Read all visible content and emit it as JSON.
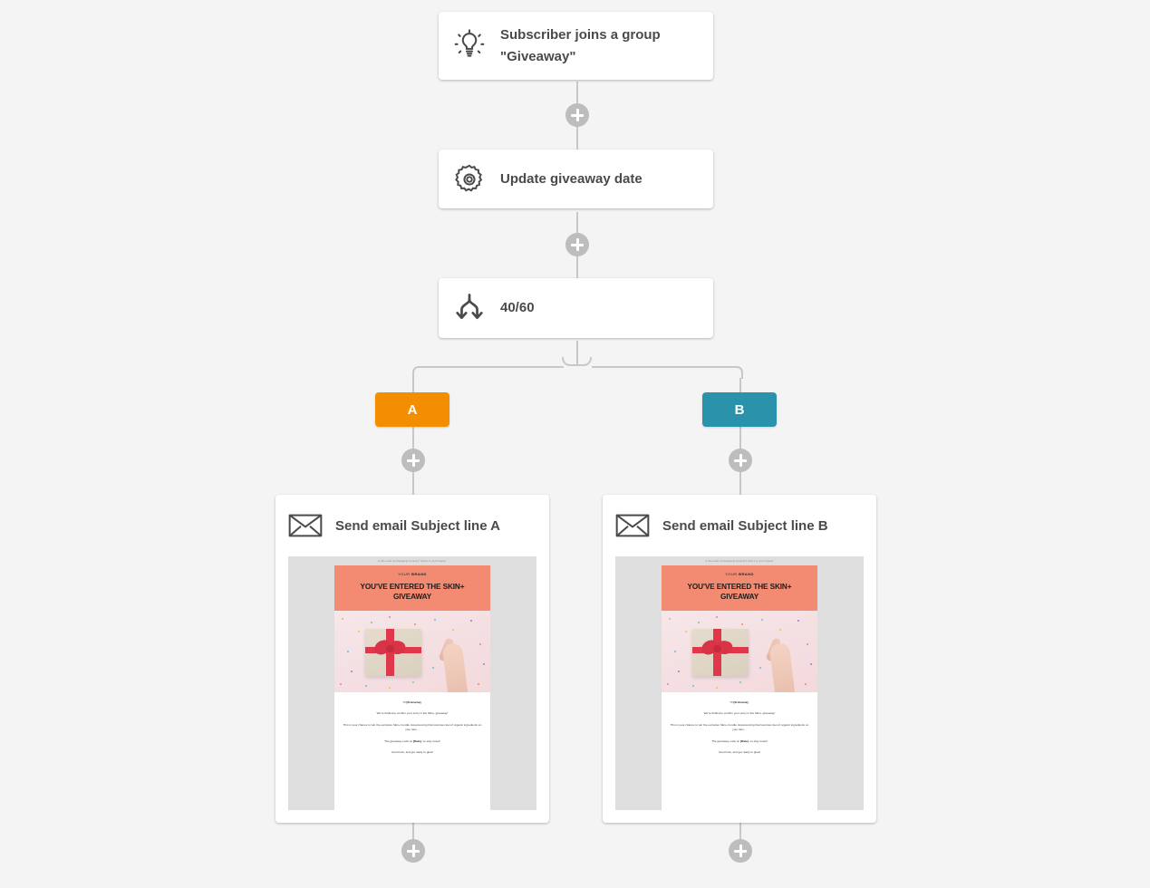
{
  "workflow": {
    "steps": [
      {
        "id": "trigger",
        "icon": "lightbulb-icon",
        "title": "Subscriber joins a group\n\"Giveaway\""
      },
      {
        "id": "action",
        "icon": "gear-icon",
        "title": "Update giveaway date"
      },
      {
        "id": "split",
        "icon": "split-branch-icon",
        "title": "40/60"
      }
    ],
    "branches": [
      {
        "id": "a",
        "label": "A",
        "color": "#f28e00",
        "email_title": "Send email Subject line A"
      },
      {
        "id": "b",
        "label": "B",
        "color": "#2a93ab",
        "email_title": "Send email Subject line B"
      }
    ],
    "add_step_label": "+"
  },
  "email_preview": {
    "preheader": "Is this email not displaying correctly? View it in your browser.",
    "brand_prefix": "YOUR ",
    "brand_bold": "BRAND",
    "headline": "YOU'VE ENTERED THE SKIN+ GIVEAWAY",
    "banner_color": "#f28b71",
    "greeting_pre": "Hi ",
    "greeting_token": "[firstname]",
    "greeting_post": ",",
    "line2": "We're thrilled to confirm your entry in the Skin+ giveaway!",
    "line3": "This is your chance to win the exclusive Skin+ bundle. Experiencing that luxurious feel of organic ingredients on your skin…",
    "line4_pre": "The giveaway ends on ",
    "line4_token": "[Date]",
    "line4_post": ", so stay tuned!",
    "line5": "Good luck, and get ready to glow!",
    "image_alt": "gift-box-with-red-ribbon-held-by-hand"
  }
}
